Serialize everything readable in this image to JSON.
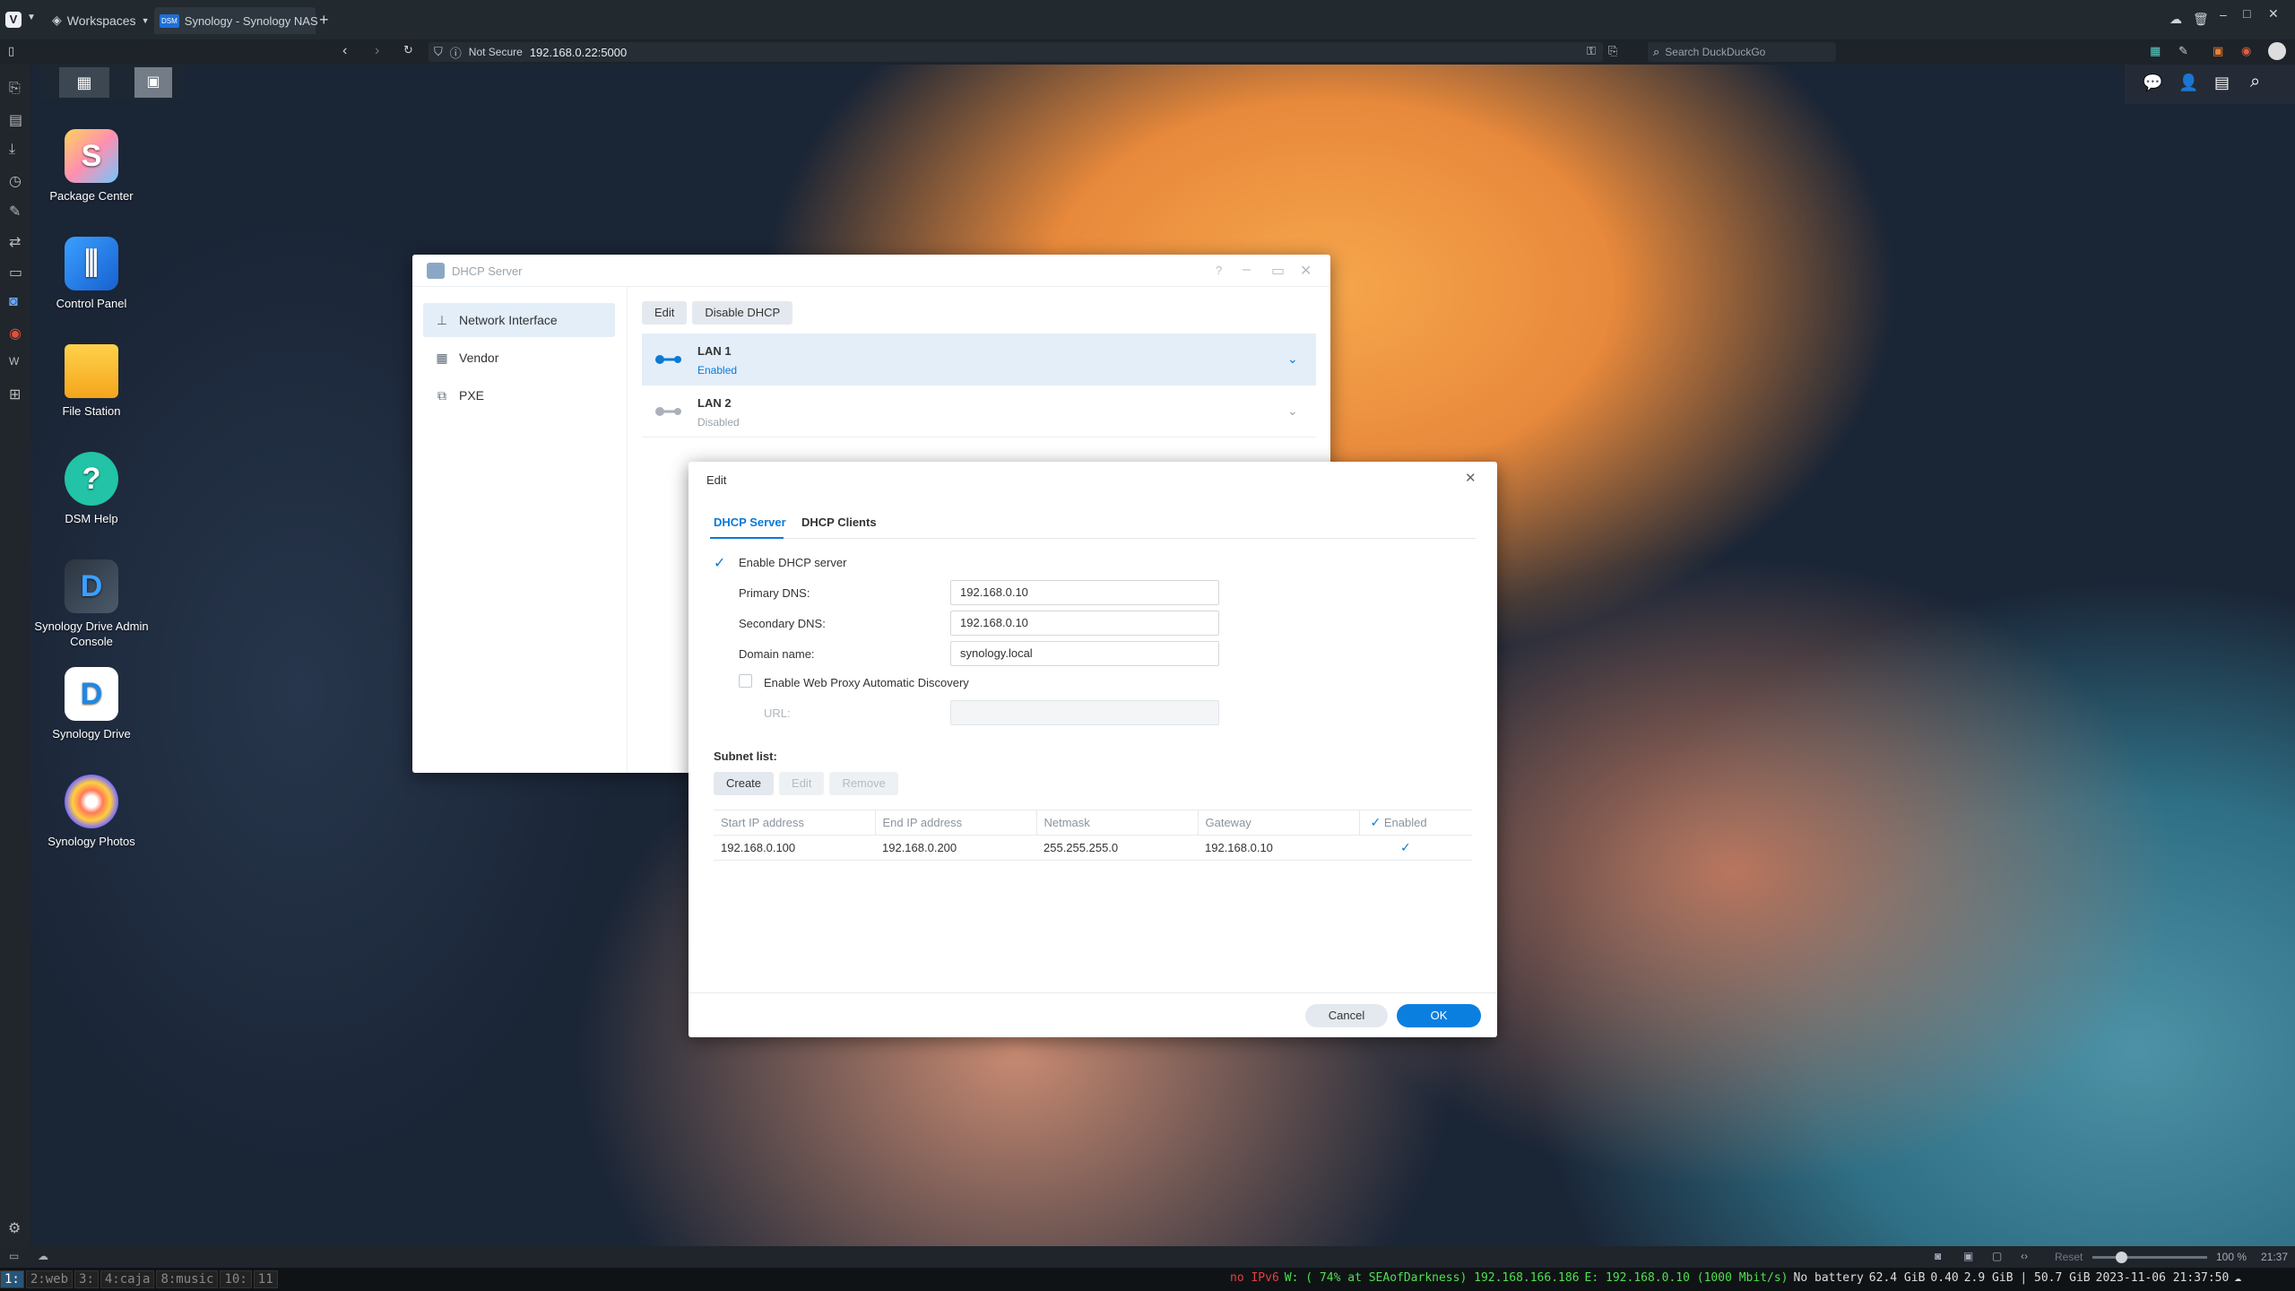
{
  "browser": {
    "workspaces_label": "Workspaces",
    "tab_title": "Synology - Synology NAS",
    "tab_favicon": "DSM",
    "not_secure": "Not Secure",
    "url": "192.168.0.22:5000",
    "search_placeholder": "Search DuckDuckGo",
    "zoom_reset": "Reset",
    "zoom_level": "100 %",
    "zoom_fraction": 0.25,
    "clock": "21:37"
  },
  "desktop": {
    "icons": [
      {
        "label": "Package Center"
      },
      {
        "label": "Control Panel"
      },
      {
        "label": "File Station"
      },
      {
        "label": "DSM Help",
        "glyph": "?"
      },
      {
        "label": "Synology Drive Admin Console"
      },
      {
        "label": "Synology Drive"
      },
      {
        "label": "Synology Photos"
      }
    ]
  },
  "dhcp_window": {
    "title": "DHCP Server",
    "nav": [
      {
        "label": "Network Interface"
      },
      {
        "label": "Vendor"
      },
      {
        "label": "PXE"
      }
    ],
    "toolbar": {
      "edit": "Edit",
      "disable": "Disable DHCP"
    },
    "interfaces": [
      {
        "name": "LAN 1",
        "status": "Enabled"
      },
      {
        "name": "LAN 2",
        "status": "Disabled"
      }
    ],
    "window_help": "?"
  },
  "edit_dialog": {
    "title": "Edit",
    "tabs": [
      "DHCP Server",
      "DHCP Clients"
    ],
    "enable_label": "Enable DHCP server",
    "primary_dns_label": "Primary DNS:",
    "primary_dns": "192.168.0.10",
    "secondary_dns_label": "Secondary DNS:",
    "secondary_dns": "192.168.0.10",
    "domain_label": "Domain name:",
    "domain": "synology.local",
    "wpad_label": "Enable Web Proxy Automatic Discovery",
    "url_label": "URL:",
    "url_value": "",
    "subnet_label": "Subnet list:",
    "subnet_buttons": {
      "create": "Create",
      "edit": "Edit",
      "remove": "Remove"
    },
    "table": {
      "headers": [
        "Start IP address",
        "End IP address",
        "Netmask",
        "Gateway",
        "Enabled"
      ],
      "rows": [
        {
          "start": "192.168.0.100",
          "end": "192.168.0.200",
          "netmask": "255.255.255.0",
          "gateway": "192.168.0.10"
        }
      ]
    },
    "cancel": "Cancel",
    "ok": "OK"
  },
  "i3": {
    "workspaces": [
      "1:",
      "2:web",
      "3:",
      "4:caja",
      "8:music",
      "10:",
      "11"
    ],
    "status": {
      "ipv6": "no IPv6",
      "wifi": "W: ( 74% at SEAofDarkness) 192.168.166.186",
      "eth": "E: 192.168.0.10 (1000 Mbit/s)",
      "battery": "No battery",
      "disk": "62.4 GiB",
      "load": "0.40",
      "mem": "2.9 GiB | 50.7 GiB",
      "datetime": "2023-11-06 21:37:50"
    }
  },
  "colors": {
    "accent": "#0a7ad6",
    "ok_button": "#0b7fe0"
  }
}
